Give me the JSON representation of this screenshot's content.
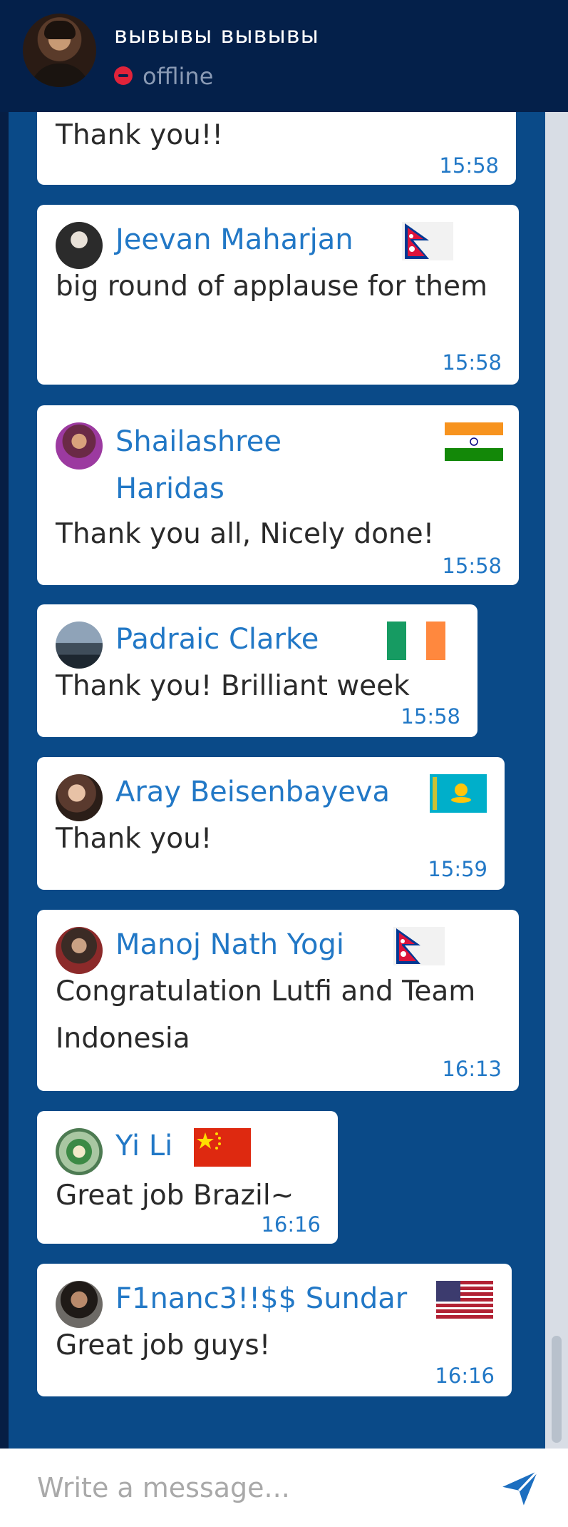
{
  "header": {
    "title": "вывывы вывывы",
    "status": "offline",
    "status_color": "#e0233a"
  },
  "colors": {
    "header_bg": "#04204a",
    "chat_bg": "#0a4a88",
    "name_color": "#2278c6",
    "time_color": "#2278c6"
  },
  "messages": [
    {
      "sender": "",
      "text": "Thank you!!",
      "time": "15:58"
    },
    {
      "sender": "Jeevan Maharjan",
      "flag": "nepal-flag-icon",
      "text": "big round of applause for them",
      "time": "15:58"
    },
    {
      "sender": "Shailashree Haridas",
      "flag": "india-flag-icon",
      "text": "Thank you all, Nicely done!",
      "time": "15:58"
    },
    {
      "sender": "Padraic Clarke",
      "flag": "ireland-flag-icon",
      "text": "Thank you! Brilliant week",
      "time": "15:58"
    },
    {
      "sender": "Aray Beisenbayeva",
      "flag": "kazakhstan-flag-icon",
      "text": "Thank you!",
      "time": "15:59"
    },
    {
      "sender": "Manoj Nath Yogi",
      "flag": "nepal-flag-icon",
      "text": "Congratulation Lutfi and Team Indonesia",
      "time": "16:13"
    },
    {
      "sender": "Yi Li",
      "flag": "china-flag-icon",
      "text": "Great job Brazil~",
      "time": "16:16"
    },
    {
      "sender": "F1nanc3!!$$ Sundar",
      "flag": "usa-flag-icon",
      "text": "Great job guys!",
      "time": "16:16"
    }
  ],
  "composer": {
    "placeholder": "Write a message...",
    "value": "",
    "send_icon": "send-icon"
  }
}
